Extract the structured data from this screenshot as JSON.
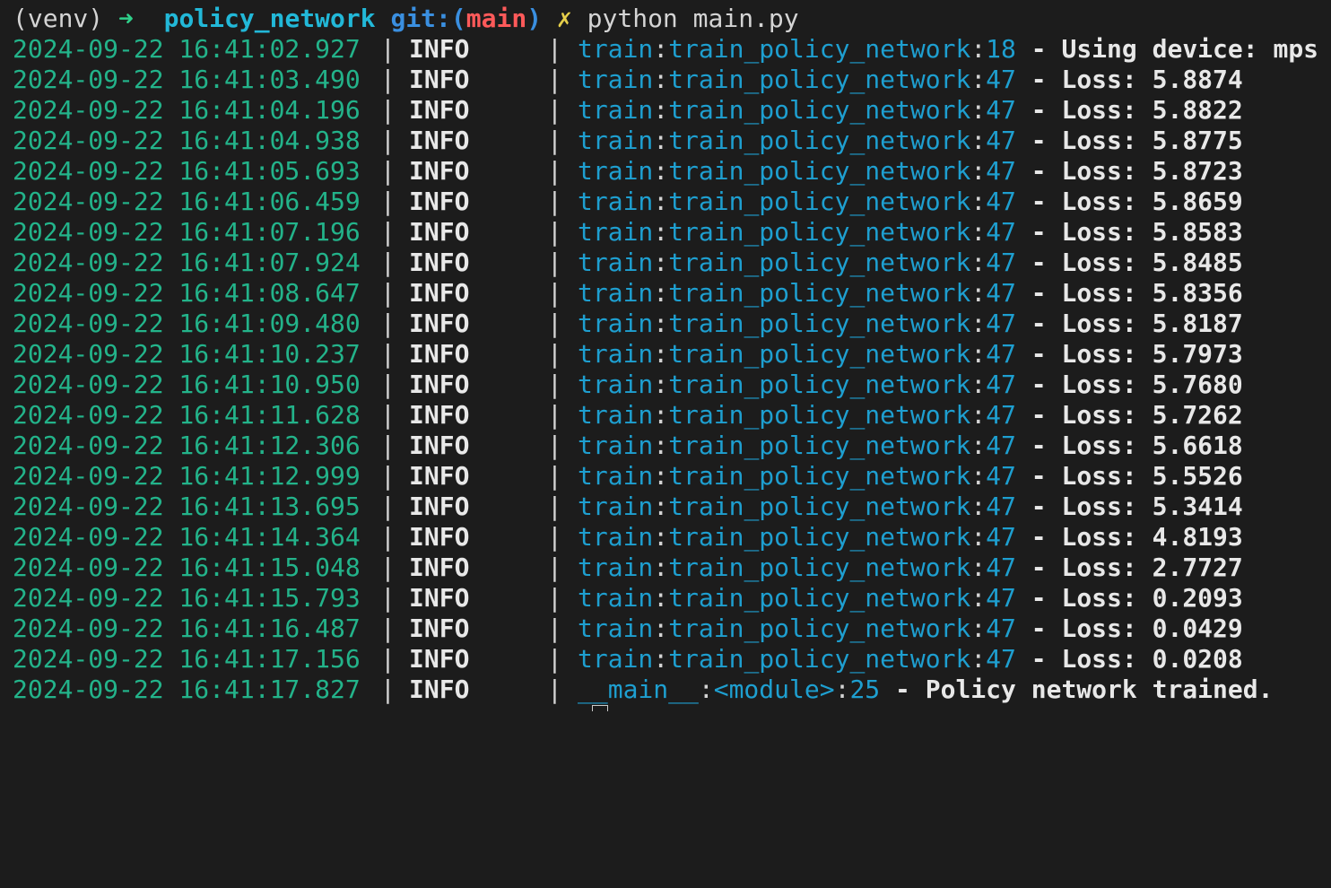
{
  "prompt": {
    "venv": "(venv)",
    "arrow": "➜",
    "directory": "policy_network",
    "git_label": "git:(",
    "branch": "main",
    "git_close": ")",
    "dirty_mark": "✗",
    "command": "python main.py"
  },
  "separator": "|",
  "log_lines": [
    {
      "timestamp": "2024-09-22 16:41:02.927",
      "level": "INFO",
      "module": "train",
      "function": "train_policy_network",
      "line": "18",
      "message": "- Using device: mps"
    },
    {
      "timestamp": "2024-09-22 16:41:03.490",
      "level": "INFO",
      "module": "train",
      "function": "train_policy_network",
      "line": "47",
      "message": "- Loss: 5.8874"
    },
    {
      "timestamp": "2024-09-22 16:41:04.196",
      "level": "INFO",
      "module": "train",
      "function": "train_policy_network",
      "line": "47",
      "message": "- Loss: 5.8822"
    },
    {
      "timestamp": "2024-09-22 16:41:04.938",
      "level": "INFO",
      "module": "train",
      "function": "train_policy_network",
      "line": "47",
      "message": "- Loss: 5.8775"
    },
    {
      "timestamp": "2024-09-22 16:41:05.693",
      "level": "INFO",
      "module": "train",
      "function": "train_policy_network",
      "line": "47",
      "message": "- Loss: 5.8723"
    },
    {
      "timestamp": "2024-09-22 16:41:06.459",
      "level": "INFO",
      "module": "train",
      "function": "train_policy_network",
      "line": "47",
      "message": "- Loss: 5.8659"
    },
    {
      "timestamp": "2024-09-22 16:41:07.196",
      "level": "INFO",
      "module": "train",
      "function": "train_policy_network",
      "line": "47",
      "message": "- Loss: 5.8583"
    },
    {
      "timestamp": "2024-09-22 16:41:07.924",
      "level": "INFO",
      "module": "train",
      "function": "train_policy_network",
      "line": "47",
      "message": "- Loss: 5.8485"
    },
    {
      "timestamp": "2024-09-22 16:41:08.647",
      "level": "INFO",
      "module": "train",
      "function": "train_policy_network",
      "line": "47",
      "message": "- Loss: 5.8356"
    },
    {
      "timestamp": "2024-09-22 16:41:09.480",
      "level": "INFO",
      "module": "train",
      "function": "train_policy_network",
      "line": "47",
      "message": "- Loss: 5.8187"
    },
    {
      "timestamp": "2024-09-22 16:41:10.237",
      "level": "INFO",
      "module": "train",
      "function": "train_policy_network",
      "line": "47",
      "message": "- Loss: 5.7973"
    },
    {
      "timestamp": "2024-09-22 16:41:10.950",
      "level": "INFO",
      "module": "train",
      "function": "train_policy_network",
      "line": "47",
      "message": "- Loss: 5.7680"
    },
    {
      "timestamp": "2024-09-22 16:41:11.628",
      "level": "INFO",
      "module": "train",
      "function": "train_policy_network",
      "line": "47",
      "message": "- Loss: 5.7262"
    },
    {
      "timestamp": "2024-09-22 16:41:12.306",
      "level": "INFO",
      "module": "train",
      "function": "train_policy_network",
      "line": "47",
      "message": "- Loss: 5.6618"
    },
    {
      "timestamp": "2024-09-22 16:41:12.999",
      "level": "INFO",
      "module": "train",
      "function": "train_policy_network",
      "line": "47",
      "message": "- Loss: 5.5526"
    },
    {
      "timestamp": "2024-09-22 16:41:13.695",
      "level": "INFO",
      "module": "train",
      "function": "train_policy_network",
      "line": "47",
      "message": "- Loss: 5.3414"
    },
    {
      "timestamp": "2024-09-22 16:41:14.364",
      "level": "INFO",
      "module": "train",
      "function": "train_policy_network",
      "line": "47",
      "message": "- Loss: 4.8193"
    },
    {
      "timestamp": "2024-09-22 16:41:15.048",
      "level": "INFO",
      "module": "train",
      "function": "train_policy_network",
      "line": "47",
      "message": "- Loss: 2.7727"
    },
    {
      "timestamp": "2024-09-22 16:41:15.793",
      "level": "INFO",
      "module": "train",
      "function": "train_policy_network",
      "line": "47",
      "message": "- Loss: 0.2093"
    },
    {
      "timestamp": "2024-09-22 16:41:16.487",
      "level": "INFO",
      "module": "train",
      "function": "train_policy_network",
      "line": "47",
      "message": "- Loss: 0.0429"
    },
    {
      "timestamp": "2024-09-22 16:41:17.156",
      "level": "INFO",
      "module": "train",
      "function": "train_policy_network",
      "line": "47",
      "message": "- Loss: 0.0208"
    },
    {
      "timestamp": "2024-09-22 16:41:17.827",
      "level": "INFO",
      "module": "__main__",
      "function": "<module>",
      "line": "25",
      "message": "- Policy network trained."
    }
  ],
  "colors": {
    "background": "#1c1c1c",
    "timestamp": "#23b38a",
    "source": "#1e9fd0",
    "branch": "#ff5a5a",
    "directory": "#22b8d8"
  }
}
